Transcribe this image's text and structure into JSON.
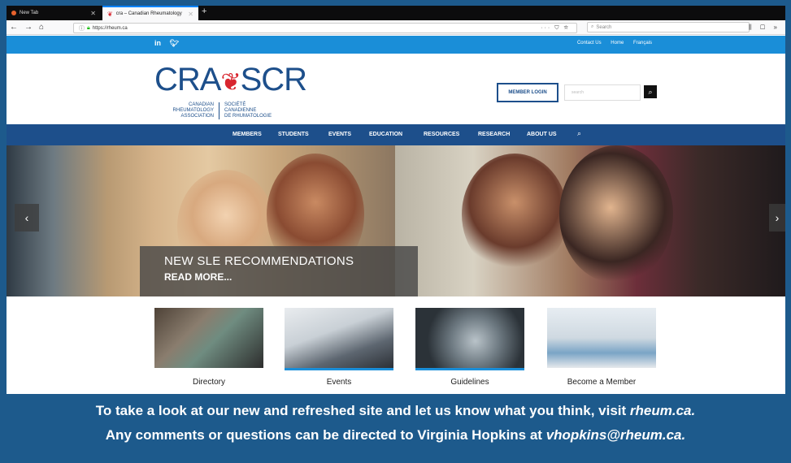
{
  "browser": {
    "tabs": [
      {
        "label": "New Tab"
      },
      {
        "label": "cra – Canadian Rheumatology"
      }
    ],
    "url": "https://rheum.ca",
    "search_placeholder": "Search"
  },
  "site": {
    "social": [
      "in",
      "y"
    ],
    "top_links": [
      "Contact Us",
      "Home",
      "Français"
    ],
    "logo": {
      "mark_left": "CRA",
      "mark_right": "SCR",
      "en_lines": [
        "CANADIAN",
        "RHEUMATOLOGY",
        "ASSOCIATION"
      ],
      "fr_lines": [
        "SOCIÉTÉ",
        "CANADIENNE",
        "DE RHUMATOLOGIE"
      ]
    },
    "member_login": "MEMBER LOGIN",
    "header_search_placeholder": "search",
    "nav": [
      "MEMBERS",
      "STUDENTS",
      "EVENTS",
      "EDUCATION",
      "RESOURCES",
      "RESEARCH",
      "ABOUT US"
    ],
    "hero": {
      "headline": "NEW SLE RECOMMENDATIONS",
      "cta": "READ MORE..."
    },
    "tiles": [
      "Directory",
      "Events",
      "Guidelines",
      "Become a Member"
    ]
  },
  "footer": {
    "line1_text": "To take a look at our new and refreshed site and let us know what you think, visit ",
    "line1_link": "rheum.ca.",
    "line2_text": "Any comments or questions can be directed to Virginia Hopkins at ",
    "line2_link": "vhopkins@rheum.ca."
  },
  "colors": {
    "frame": "#1d5a8c",
    "site_blue": "#1a8ed8",
    "nav_navy": "#1d4f8b",
    "maple_red": "#d8262f"
  }
}
